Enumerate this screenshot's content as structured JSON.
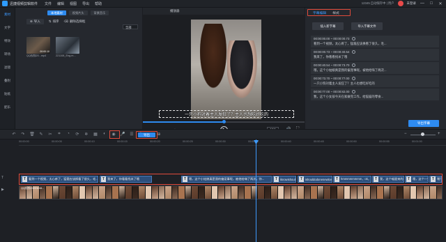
{
  "app": {
    "title": "迅捷视频剪辑软件",
    "menu": [
      "文件",
      "编辑",
      "视图",
      "导出",
      "帮助"
    ],
    "account_info": "12345 自动保存中 | 用户",
    "login_label": "未登录",
    "window_controls": [
      "—",
      "□",
      "✕"
    ]
  },
  "rail": {
    "items": [
      "素材",
      "文字",
      "特效",
      "转场",
      "滤镜",
      "叠附",
      "贴纸",
      "配乐"
    ],
    "active_index": 0
  },
  "media": {
    "tabs": [
      "本地素材",
      "视频片头",
      "背景音乐"
    ],
    "active_tab": 0,
    "tools": {
      "import": "导入",
      "sort": "排序",
      "delete": "删除选择框"
    },
    "sort_select": "全部",
    "files": [
      {
        "duration": "00:00:10",
        "name": "QQ视频20...mp4"
      },
      {
        "duration": "",
        "name": "221108_Eng.m..."
      }
    ]
  },
  "player": {
    "header": "播放器",
    "subtitle": "一只小狗对着主人发狂了？主人也想吃好吃的",
    "progress": 0.5,
    "time_current": "00:00:00.73",
    "time_total": "/ 00:01:02.88",
    "play_icon": "▶",
    "ratio": "16:9",
    "volume_icon": "🔊",
    "fullscreen_icon": "⛶"
  },
  "subtitle_panel": {
    "tabs": [
      "字幕编辑",
      "样式"
    ],
    "active_tab": 0,
    "buttons": [
      "插入新字幕",
      "导入字幕文件"
    ],
    "items": [
      {
        "time": "00:00:00.00 ~ 00:00:00.73",
        "text": "看到一个视频，太心疼了，猛箍应该换看了很久，毛..."
      },
      {
        "time": "00:00:00.73 ~ 00:00:40.54",
        "text": "我来了，你看看找米了哦"
      },
      {
        "time": "00:00:40.54 ~ 00:00:73.70",
        "text": "哦，这个小姑娘真是我的偏宠事呢，被他给嗨了两次..."
      },
      {
        "time": "00:00:73.70 ~ 00:00:77.00",
        "text": "一只小狗对着主人发狂了？主人也想吃好吃的"
      },
      {
        "time": "00:00:77.00 ~ 00:00:82.00",
        "text": "我，这个小女孩今天在家做完工作，给猫猫的零食..."
      }
    ],
    "export_button": "导出字幕"
  },
  "timeline_toolbar": {
    "icons": [
      "undo",
      "redo",
      "delete",
      "edit",
      "split",
      "crop",
      "speed",
      "rotate",
      "freeze",
      "mosaic",
      "color",
      "record",
      "mic",
      "list",
      "text",
      "subtitle",
      "add"
    ],
    "export_label": "导出",
    "zoom_minus": "−",
    "zoom_plus": "+",
    "zoom_level": 0.48
  },
  "timeline": {
    "ruler": [
      "00:00:00",
      "00:00:05",
      "00:00:10",
      "00:00:15",
      "00:00:20",
      "00:00:25",
      "00:00:30",
      "00:00:35",
      "00:00:40",
      "00:00:45",
      "00:00:50",
      "00:00:55",
      "00:01:00"
    ],
    "track_labels": [
      "T",
      "▶"
    ],
    "subtitle_clips": [
      "看到一个视频，太心疼了，猛箍应该换看了很久，毛..",
      "我来了，你看看找米了哦",
      "哦，这个小姑娘真是我的偏宠事呢，被他给嗨了两次，你...",
      "iknowishould...",
      "ishouldodonenewlov...",
      "hmmmmmmmm，ok，这个...",
      "我，这个喵星来的小家伙，..",
      "哦，这个一只职业...",
      "嘿？嘿可嘿..."
    ],
    "video_clip_label": "QQ视频20221108..."
  },
  "colors": {
    "accent": "#2e8bf0",
    "highlight": "#e24b3b",
    "panel": "#25282e",
    "background": "#1b1d22"
  }
}
